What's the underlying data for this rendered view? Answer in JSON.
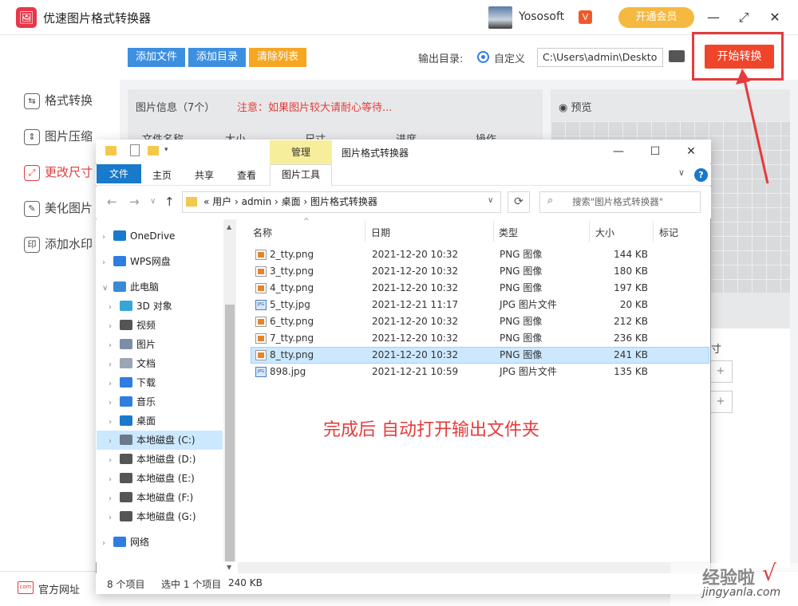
{
  "app": {
    "title": "优速图片格式转换器",
    "logo": "🖼",
    "user_name": "Yososoft",
    "vip_badge": "V",
    "vip_button": "开通会员",
    "minimize": "—",
    "maximize": "⤢",
    "close": "✕"
  },
  "sidebar": {
    "items": [
      {
        "label": "格式转换",
        "icon": "⇆"
      },
      {
        "label": "图片压缩",
        "icon": "⇕"
      },
      {
        "label": "更改尺寸",
        "icon": "⤢"
      },
      {
        "label": "美化图片",
        "icon": "✎"
      },
      {
        "label": "添加水印",
        "icon": "印"
      }
    ]
  },
  "toolbar": {
    "add_file": "添加文件",
    "add_dir": "添加目录",
    "clear_list": "清除列表",
    "output_label": "输出目录:",
    "output_option": "自定义",
    "output_path": "C:\\Users\\admin\\Deskto",
    "start_button": "开始转换"
  },
  "panel": {
    "info_title": "图片信息（7个）",
    "info_note": "注意：如果图片较大请耐心等待...",
    "preview_label": "预览",
    "col_name": "文件名称",
    "col_size": "大小",
    "col_dim": "尺寸",
    "col_progress": "进度",
    "col_action": "操作",
    "size_label": "尺寸",
    "plus": "+"
  },
  "footer": {
    "link": "官方网址",
    "link_icon": "com"
  },
  "watermark": {
    "main": "经验啦",
    "sub": "jingyanla.com",
    "check": "√"
  },
  "explorer": {
    "title": "图片格式转换器",
    "manage_tab": "管理",
    "ribbon_tabs": {
      "file": "文件",
      "home": "主页",
      "share": "共享",
      "view": "查看",
      "picture_tools": "图片工具"
    },
    "help": "?",
    "chevron": "∨",
    "win": {
      "minimize": "—",
      "maximize": "☐",
      "close": "✕"
    },
    "nav": {
      "back": "←",
      "forward": "→",
      "recent": "∨",
      "up": "↑"
    },
    "address": "«  用户  ›  admin  ›  桌面  ›  图片格式转换器",
    "search_placeholder": "搜索\"图片格式转换器\"",
    "refresh": "⟳",
    "columns": {
      "name": "名称",
      "date": "日期",
      "type": "类型",
      "size": "大小",
      "tag": "标记"
    },
    "navpane": [
      {
        "label": "OneDrive",
        "color": "#1979ca",
        "chev": "›"
      },
      {
        "label": "WPS网盘",
        "color": "#2f7de1",
        "chev": "›"
      },
      {
        "label": "此电脑",
        "color": "#3a8ad6",
        "chev": "∨"
      },
      {
        "label": "3D 对象",
        "color": "#35a7d6",
        "chev": "›"
      },
      {
        "label": "视频",
        "color": "#555555",
        "chev": "›"
      },
      {
        "label": "图片",
        "color": "#7b8ea8",
        "chev": "›"
      },
      {
        "label": "文档",
        "color": "#9aa6b5",
        "chev": "›"
      },
      {
        "label": "下载",
        "color": "#2f7de1",
        "chev": "›"
      },
      {
        "label": "音乐",
        "color": "#2f7de1",
        "chev": "›"
      },
      {
        "label": "桌面",
        "color": "#1979ca",
        "chev": "›"
      },
      {
        "label": "本地磁盘 (C:)",
        "color": "#6a7a8a",
        "chev": "›"
      },
      {
        "label": "本地磁盘 (D:)",
        "color": "#555555",
        "chev": "›"
      },
      {
        "label": "本地磁盘 (E:)",
        "color": "#555555",
        "chev": "›"
      },
      {
        "label": "本地磁盘 (F:)",
        "color": "#555555",
        "chev": "›"
      },
      {
        "label": "本地磁盘 (G:)",
        "color": "#555555",
        "chev": "›"
      },
      {
        "label": "网络",
        "color": "#2f7de1",
        "chev": "›"
      }
    ],
    "files": [
      {
        "name": "2_tty.png",
        "date": "2021-12-20 10:32",
        "type": "PNG 图像",
        "size": "144 KB",
        "kind": "png"
      },
      {
        "name": "3_tty.png",
        "date": "2021-12-20 10:32",
        "type": "PNG 图像",
        "size": "180 KB",
        "kind": "png"
      },
      {
        "name": "4_tty.png",
        "date": "2021-12-20 10:32",
        "type": "PNG 图像",
        "size": "197 KB",
        "kind": "png"
      },
      {
        "name": "5_tty.jpg",
        "date": "2021-12-21 11:17",
        "type": "JPG 图片文件",
        "size": "20 KB",
        "kind": "jpg"
      },
      {
        "name": "6_tty.png",
        "date": "2021-12-20 10:32",
        "type": "PNG 图像",
        "size": "212 KB",
        "kind": "png"
      },
      {
        "name": "7_tty.png",
        "date": "2021-12-20 10:32",
        "type": "PNG 图像",
        "size": "236 KB",
        "kind": "png"
      },
      {
        "name": "8_tty.png",
        "date": "2021-12-20 10:32",
        "type": "PNG 图像",
        "size": "241 KB",
        "kind": "png",
        "selected": true
      },
      {
        "name": "898.jpg",
        "date": "2021-12-21 10:59",
        "type": "JPG 图片文件",
        "size": "135 KB",
        "kind": "jpg"
      }
    ],
    "status": {
      "count": "8 个项目",
      "selected": "选中 1 个项目",
      "size": "240 KB"
    }
  },
  "annotation": {
    "text": "完成后 自动打开输出文件夹",
    "color": "#e53b3b"
  },
  "colors": {
    "accent": "#f0452a",
    "blue_btn": "#3d8fe0",
    "orange_btn": "#f5a623",
    "explorer_blue": "#1979ca"
  }
}
